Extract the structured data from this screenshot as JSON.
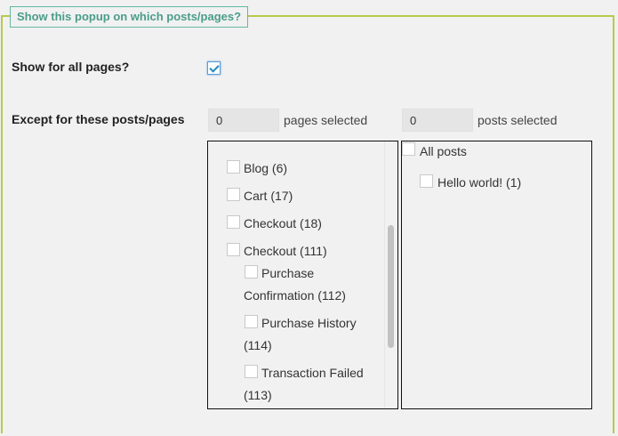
{
  "legend": "Show this popup on which posts/pages?",
  "show_all": {
    "label": "Show for all pages?",
    "checked": true
  },
  "except": {
    "label": "Except for these posts/pages",
    "pages_count": "0",
    "pages_label": "pages selected",
    "posts_count": "0",
    "posts_label": "posts selected"
  },
  "pages": [
    {
      "label": "Blog (6)"
    },
    {
      "label": "Cart (17)"
    },
    {
      "label": "Checkout (18)"
    },
    {
      "label": "Checkout (111)"
    },
    {
      "label_line1": "Purchase",
      "label_line2": "Confirmation (112)"
    },
    {
      "label_line1": "Purchase History",
      "label_line2": "(114)"
    },
    {
      "label_line1": "Transaction Failed",
      "label_line2": "(113)"
    }
  ],
  "posts": [
    {
      "label": "All posts"
    },
    {
      "label": "Hello world! (1)"
    }
  ]
}
